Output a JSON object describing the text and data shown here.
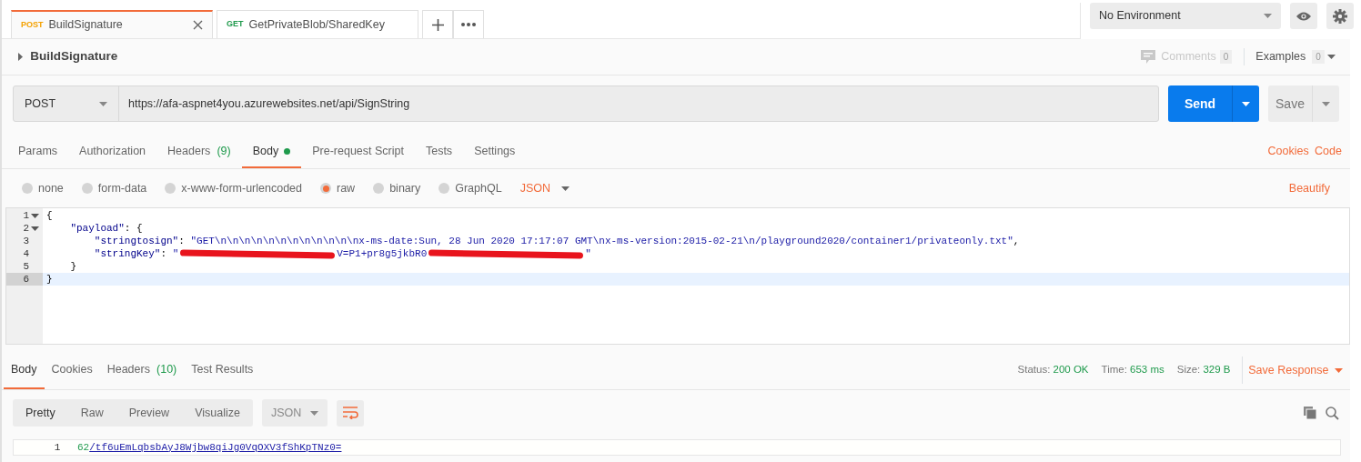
{
  "request_tabs": [
    {
      "method": "POST",
      "name": "BuildSignature",
      "selected": true,
      "closable": true
    },
    {
      "method": "GET",
      "name": "GetPrivateBlob/SharedKey",
      "selected": false,
      "closable": false
    }
  ],
  "environment": {
    "value": "No Environment"
  },
  "request_title": "BuildSignature",
  "comments": {
    "label": "Comments",
    "count": "0",
    "disabled": true
  },
  "examples": {
    "label": "Examples",
    "count": "0"
  },
  "request": {
    "method": "POST",
    "url": "https://afa-aspnet4you.azurewebsites.net/api/SignString",
    "send": "Send",
    "save": "Save"
  },
  "request_sections": [
    {
      "label": "Params",
      "selected": false
    },
    {
      "label": "Authorization",
      "selected": false
    },
    {
      "label": "Headers",
      "count": "(9)",
      "selected": false
    },
    {
      "label": "Body",
      "selected": true,
      "dot": true
    },
    {
      "label": "Pre-request Script",
      "selected": false
    },
    {
      "label": "Tests",
      "selected": false
    },
    {
      "label": "Settings",
      "selected": false
    }
  ],
  "section_links": [
    "Cookies",
    "Code"
  ],
  "body_types": [
    {
      "label": "none",
      "selected": false
    },
    {
      "label": "form-data",
      "selected": false
    },
    {
      "label": "x-www-form-urlencoded",
      "selected": false
    },
    {
      "label": "raw",
      "selected": true
    },
    {
      "label": "binary",
      "selected": false
    },
    {
      "label": "GraphQL",
      "selected": false
    }
  ],
  "body_format": "JSON",
  "beautify": "Beautify",
  "editor_lines": [
    {
      "number": "1",
      "fold": true,
      "active": false,
      "segments": [
        {
          "kind": "plain",
          "text": "{"
        }
      ]
    },
    {
      "number": "2",
      "fold": true,
      "active": false,
      "segments": [
        {
          "kind": "key",
          "text": "    \"payload\""
        },
        {
          "kind": "plain",
          "text": ": {"
        }
      ]
    },
    {
      "number": "3",
      "fold": false,
      "active": false,
      "segments": [
        {
          "kind": "key",
          "text": "        \"stringtosign\""
        },
        {
          "kind": "plain",
          "text": ": "
        },
        {
          "kind": "string",
          "text": "\"GET\\n\\n\\n\\n\\n\\n\\n\\n\\n\\n\\n\\nx-ms-date:Sun, 28 Jun 2020 17:17:07 GMT\\nx-ms-version:2015-02-21\\n/playground2020/container1/privateonly.txt\""
        },
        {
          "kind": "plain",
          "text": ","
        }
      ]
    },
    {
      "number": "4",
      "fold": false,
      "active": false,
      "segments": [
        {
          "kind": "key",
          "text": "        \"stringKey\""
        },
        {
          "kind": "plain",
          "text": ": "
        },
        {
          "kind": "string",
          "text": "\""
        },
        {
          "kind": "redacted"
        },
        {
          "kind": "string",
          "text": "V=P1+pr8g5jkbR0"
        },
        {
          "kind": "redacted"
        },
        {
          "kind": "string",
          "text": "\""
        }
      ]
    },
    {
      "number": "5",
      "fold": false,
      "active": false,
      "segments": [
        {
          "kind": "plain",
          "text": "    }"
        }
      ]
    },
    {
      "number": "6",
      "fold": false,
      "active": true,
      "segments": [
        {
          "kind": "plain",
          "text": "}"
        }
      ]
    }
  ],
  "response_tabs": [
    {
      "label": "Body",
      "selected": true
    },
    {
      "label": "Cookies",
      "selected": false
    },
    {
      "label": "Headers",
      "count": "(10)",
      "selected": false
    },
    {
      "label": "Test Results",
      "selected": false
    }
  ],
  "response_stats": [
    {
      "label": "Status:",
      "value": "200 OK"
    },
    {
      "label": "Time:",
      "value": "653 ms"
    },
    {
      "label": "Size:",
      "value": "329 B"
    }
  ],
  "save_response": "Save Response",
  "view_modes": [
    {
      "label": "Pretty",
      "selected": true
    },
    {
      "label": "Raw",
      "selected": false
    },
    {
      "label": "Preview",
      "selected": false
    },
    {
      "label": "Visualize",
      "selected": false
    }
  ],
  "response_format": "JSON",
  "response_lines": [
    {
      "number": "1",
      "segments": [
        {
          "kind": "number",
          "text": "62"
        },
        {
          "kind": "link",
          "text": "/tf6uEmLqbsbAyJ8Wjbw8qiJg0VqOXV3fShKpTNz0="
        }
      ]
    }
  ]
}
